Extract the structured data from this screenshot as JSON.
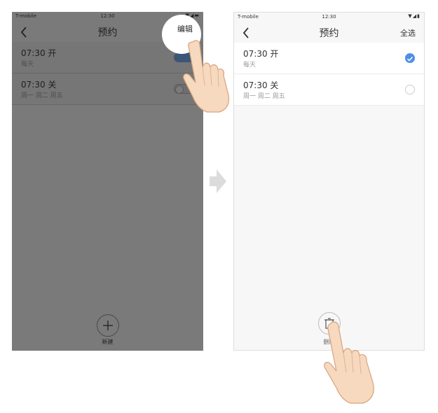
{
  "left_screen": {
    "status": {
      "carrier": "T-mobile",
      "time": "12:30"
    },
    "nav": {
      "title": "预约",
      "action": "编辑"
    },
    "items": [
      {
        "time": "07:30",
        "label": "开",
        "days": "每天",
        "toggle": "on"
      },
      {
        "time": "07:30",
        "label": "关",
        "days": "周一  周二  周五",
        "toggle": "off"
      }
    ],
    "bottom_button": {
      "icon": "plus-icon",
      "label": "新建"
    }
  },
  "right_screen": {
    "status": {
      "carrier": "T-mobile",
      "time": "12:30"
    },
    "nav": {
      "title": "预约",
      "action": "全选"
    },
    "items": [
      {
        "time": "07:30",
        "label": "开",
        "days": "每天",
        "selected": true
      },
      {
        "time": "07:30",
        "label": "关",
        "days": "周一  周二  周五",
        "selected": false
      }
    ],
    "bottom_button": {
      "icon": "trash-icon",
      "label": "删除"
    }
  },
  "colors": {
    "accent": "#4d8fe8",
    "toggle_on": "#3b5677",
    "dim_overlay": "#7a7a7a"
  }
}
